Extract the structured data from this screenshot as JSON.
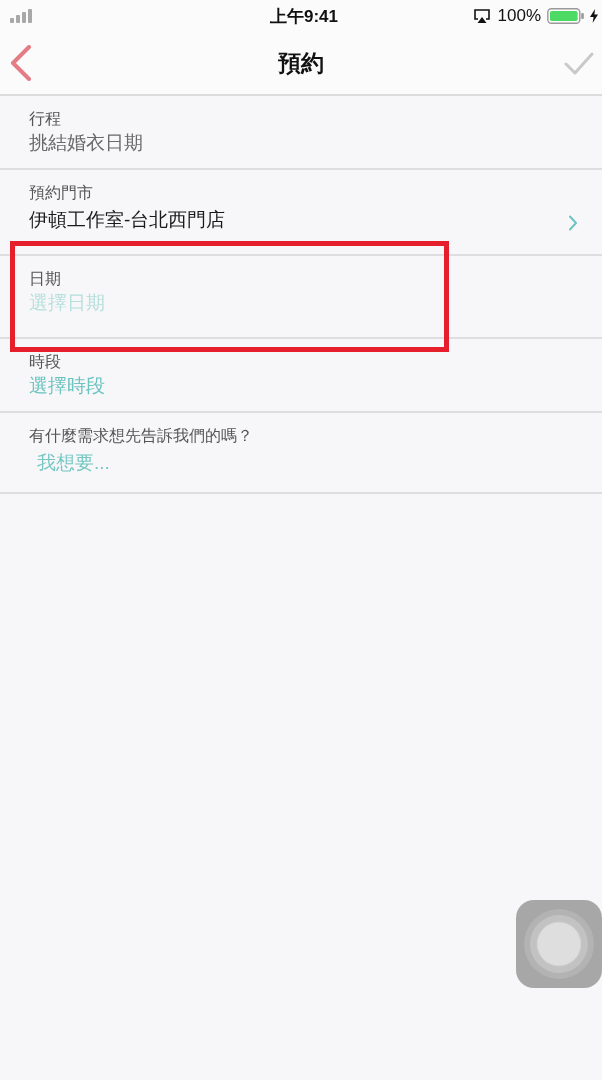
{
  "status_bar": {
    "time": "上午9:41",
    "battery_text": "100%",
    "charging": true
  },
  "nav_bar": {
    "title": "預約",
    "confirm": {
      "disabled": true
    }
  },
  "fields": [
    {
      "kind": "text",
      "label": "行程",
      "value": "挑結婚衣日期",
      "disabled": true,
      "highlighted": false
    },
    {
      "kind": "select",
      "label": "預約門市",
      "value": "伊頓工作室-台北西門店",
      "disabled": false,
      "highlighted": false
    },
    {
      "kind": "picker",
      "label": "日期",
      "value": "選擇日期",
      "disabled": true,
      "highlighted": true
    },
    {
      "kind": "picker",
      "label": "時段",
      "value": "選擇時段",
      "disabled": false,
      "highlighted": false
    },
    {
      "kind": "input",
      "label": "有什麼需求想先告訴我們的嗎？",
      "placeholder": "我想要...",
      "disabled": false,
      "highlighted": false
    }
  ]
}
